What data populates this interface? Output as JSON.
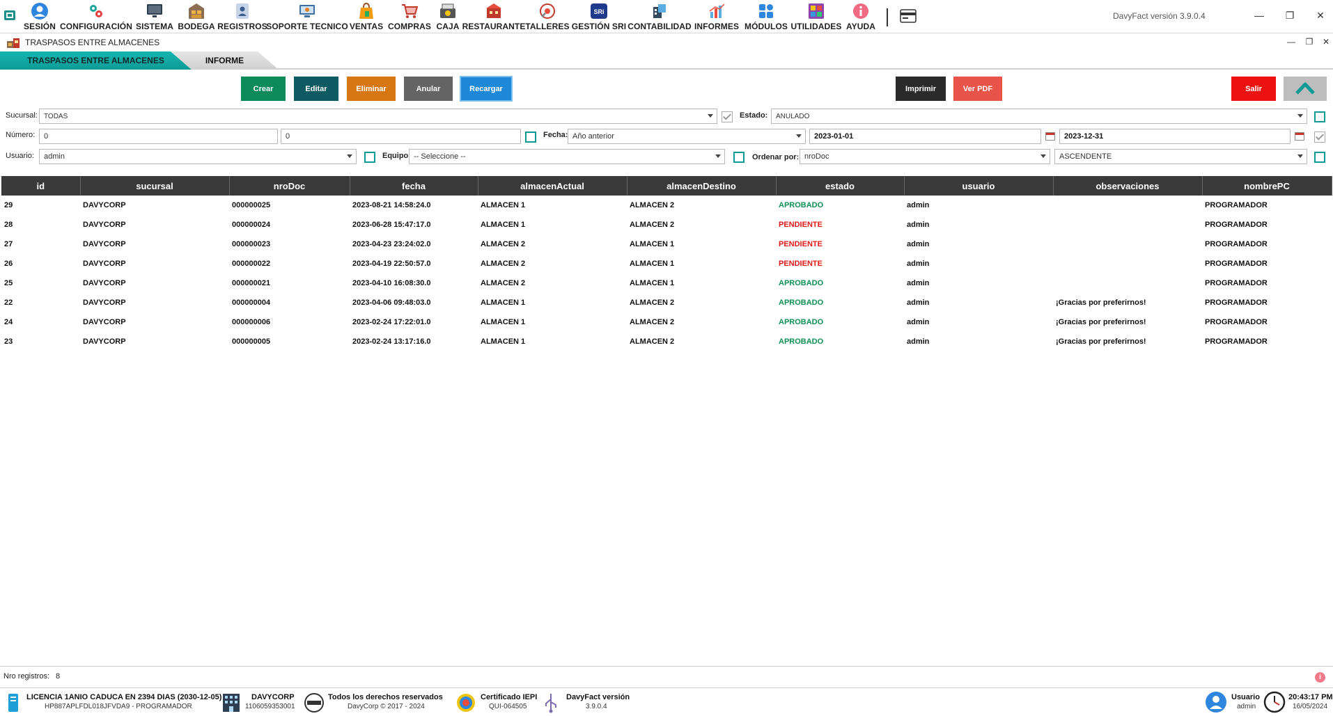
{
  "app": {
    "title": "DavyFact versión 3.9.0.4"
  },
  "menu": [
    {
      "label": "SESIÓN",
      "icon": "user-circle-icon"
    },
    {
      "label": "CONFIGURACIÓN",
      "icon": "gears-icon"
    },
    {
      "label": "SISTEMA",
      "icon": "monitor-icon"
    },
    {
      "label": "BODEGA",
      "icon": "warehouse-icon"
    },
    {
      "label": "REGISTROS",
      "icon": "contact-card-icon"
    },
    {
      "label": "SOPORTE TECNICO",
      "icon": "support-icon"
    },
    {
      "label": "VENTAS",
      "icon": "shopping-bag-icon"
    },
    {
      "label": "COMPRAS",
      "icon": "cart-icon"
    },
    {
      "label": "CAJA",
      "icon": "cash-register-icon"
    },
    {
      "label": "RESTAURANTE",
      "icon": "restaurant-icon"
    },
    {
      "label": "TALLERES",
      "icon": "workshop-icon"
    },
    {
      "label": "GESTIÓN SRI",
      "icon": "sri-icon"
    },
    {
      "label": "CONTABILIDAD",
      "icon": "accounting-icon"
    },
    {
      "label": "INFORMES",
      "icon": "chart-icon"
    },
    {
      "label": "MÓDULOS",
      "icon": "modules-icon"
    },
    {
      "label": "UTILIDADES",
      "icon": "utilities-icon"
    },
    {
      "label": "AYUDA",
      "icon": "info-icon"
    }
  ],
  "child_window": {
    "title": "TRASPASOS ENTRE ALMACENES"
  },
  "tabs": [
    {
      "label": "TRASPASOS ENTRE ALMACENES",
      "active": true
    },
    {
      "label": "INFORME",
      "active": false
    }
  ],
  "toolbar": {
    "crear": "Crear",
    "editar": "Editar",
    "eliminar": "Eliminar",
    "anular": "Anular",
    "recargar": "Recargar",
    "imprimir": "Imprimir",
    "ver_pdf": "Ver PDF",
    "salir": "Salir"
  },
  "filters": {
    "sucursal_label": "Sucursal:",
    "sucursal_value": "TODAS",
    "estado_label": "Estado:",
    "estado_value": "ANULADO",
    "numero_label": "Número:",
    "numero_from": "0",
    "numero_to": "0",
    "fecha_label": "Fecha:",
    "fecha_value": "Año anterior",
    "fecha_desde": "2023-01-01",
    "fecha_hasta": "2023-12-31",
    "usuario_label": "Usuario:",
    "usuario_value": "admin",
    "equipo_label": "Equipo:",
    "equipo_value": "-- Seleccione --",
    "ordenar_label": "Ordenar por:",
    "ordenar_value": "nroDoc",
    "orden_value": "ASCENDENTE"
  },
  "table": {
    "columns": [
      "id",
      "sucursal",
      "nroDoc",
      "fecha",
      "almacenActual",
      "almacenDestino",
      "estado",
      "usuario",
      "observaciones",
      "nombrePC"
    ],
    "rows": [
      [
        "29",
        "DAVYCORP",
        "000000025",
        "2023-08-21 14:58:24.0",
        "ALMACEN 1",
        "ALMACEN 2",
        "APROBADO",
        "admin",
        "",
        "PROGRAMADOR"
      ],
      [
        "28",
        "DAVYCORP",
        "000000024",
        "2023-06-28 15:47:17.0",
        "ALMACEN 1",
        "ALMACEN 2",
        "PENDIENTE",
        "admin",
        "",
        "PROGRAMADOR"
      ],
      [
        "27",
        "DAVYCORP",
        "000000023",
        "2023-04-23 23:24:02.0",
        "ALMACEN 2",
        "ALMACEN 1",
        "PENDIENTE",
        "admin",
        "",
        "PROGRAMADOR"
      ],
      [
        "26",
        "DAVYCORP",
        "000000022",
        "2023-04-19 22:50:57.0",
        "ALMACEN 2",
        "ALMACEN 1",
        "PENDIENTE",
        "admin",
        "",
        "PROGRAMADOR"
      ],
      [
        "25",
        "DAVYCORP",
        "000000021",
        "2023-04-10 16:08:30.0",
        "ALMACEN 2",
        "ALMACEN 1",
        "APROBADO",
        "admin",
        "",
        "PROGRAMADOR"
      ],
      [
        "22",
        "DAVYCORP",
        "000000004",
        "2023-04-06 09:48:03.0",
        "ALMACEN 1",
        "ALMACEN 2",
        "APROBADO",
        "admin",
        "¡Gracias por preferirnos!",
        "PROGRAMADOR"
      ],
      [
        "24",
        "DAVYCORP",
        "000000006",
        "2023-02-24 17:22:01.0",
        "ALMACEN 1",
        "ALMACEN 2",
        "APROBADO",
        "admin",
        "¡Gracias por preferirnos!",
        "PROGRAMADOR"
      ],
      [
        "23",
        "DAVYCORP",
        "000000005",
        "2023-02-24 13:17:16.0",
        "ALMACEN 1",
        "ALMACEN 2",
        "APROBADO",
        "admin",
        "¡Gracias por preferirnos!",
        "PROGRAMADOR"
      ]
    ]
  },
  "footer": {
    "nro_registros_label": "Nro registros:",
    "nro_registros_value": "8"
  },
  "statusbar": {
    "licencia_line1": "LICENCIA 1ANIO CADUCA EN 2394 DIAS (2030-12-05)",
    "licencia_line2": "HP887APLFDL018JFVDA9 - PROGRAMADOR",
    "empresa_line1": "DAVYCORP",
    "empresa_line2": "1106059353001",
    "derechos_line1": "Todos los derechos reservados",
    "derechos_line2": "DavyCorp © 2017 - 2024",
    "cert_line1": "Certificado IEPI",
    "cert_line2": "QUI-064505",
    "version_line1": "DavyFact versión",
    "version_line2": "3.9.0.4",
    "usuario_line1": "Usuario",
    "usuario_line2": "admin",
    "time": "20:43:17 PM",
    "date": "16/05/2024"
  },
  "colors": {
    "accent_teal": "#0d9b96",
    "aprobado": "#0e8f55",
    "pendiente": "#e01818",
    "header_dark": "#3a3a3a"
  }
}
